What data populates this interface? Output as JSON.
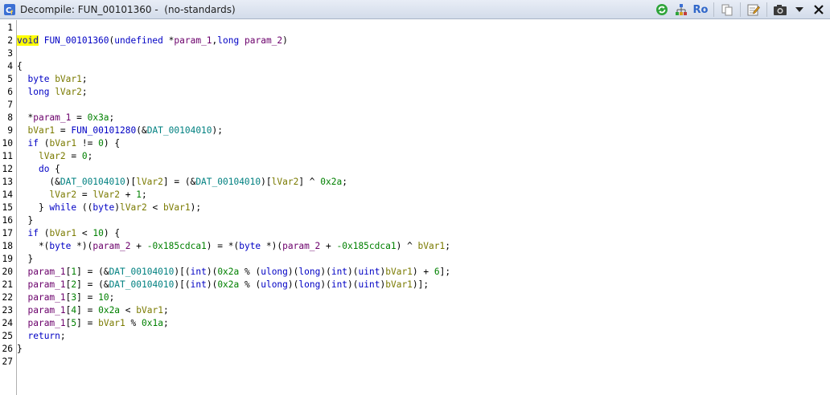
{
  "window": {
    "title": "Decompile: FUN_00101360 -  (no-standards)"
  },
  "toolbar": {
    "ro_label": "Ro",
    "icons": [
      "refresh-icon",
      "graph-icon",
      "read-only-icon",
      "copy-icon",
      "edit-icon",
      "snapshot-icon",
      "menu-dropdown-icon",
      "close-icon"
    ]
  },
  "colors": {
    "keyword": "#0000c4",
    "variable": "#7a7a00",
    "parameter": "#6b006b",
    "constant": "#008000",
    "global": "#008080",
    "highlight": "#ffff00"
  },
  "line_numbers": [
    "1",
    "2",
    "3",
    "4",
    "5",
    "6",
    "7",
    "8",
    "9",
    "10",
    "11",
    "12",
    "13",
    "14",
    "15",
    "16",
    "17",
    "18",
    "19",
    "20",
    "21",
    "22",
    "23",
    "24",
    "25",
    "26",
    "27"
  ],
  "code_lines": [
    [],
    [
      [
        "kw",
        "void"
      ],
      [
        "pl",
        " "
      ],
      [
        "fn",
        "FUN_00101360"
      ],
      [
        "pl",
        "("
      ],
      [
        "ty",
        "undefined"
      ],
      [
        "pl",
        " *"
      ],
      [
        "pm",
        "param_1"
      ],
      [
        "pl",
        ","
      ],
      [
        "ty",
        "long"
      ],
      [
        "pl",
        " "
      ],
      [
        "pm",
        "param_2"
      ],
      [
        "pl",
        ")"
      ]
    ],
    [],
    [
      [
        "pl",
        "{"
      ]
    ],
    [
      [
        "pl",
        "  "
      ],
      [
        "ty",
        "byte"
      ],
      [
        "pl",
        " "
      ],
      [
        "vr",
        "bVar1"
      ],
      [
        "pl",
        ";"
      ]
    ],
    [
      [
        "pl",
        "  "
      ],
      [
        "ty",
        "long"
      ],
      [
        "pl",
        " "
      ],
      [
        "vr",
        "lVar2"
      ],
      [
        "pl",
        ";"
      ]
    ],
    [],
    [
      [
        "pl",
        "  *"
      ],
      [
        "pm",
        "param_1"
      ],
      [
        "pl",
        " = "
      ],
      [
        "nm",
        "0x3a"
      ],
      [
        "pl",
        ";"
      ]
    ],
    [
      [
        "pl",
        "  "
      ],
      [
        "vr",
        "bVar1"
      ],
      [
        "pl",
        " = "
      ],
      [
        "fn",
        "FUN_00101280"
      ],
      [
        "pl",
        "(&"
      ],
      [
        "gv",
        "DAT_00104010"
      ],
      [
        "pl",
        ");"
      ]
    ],
    [
      [
        "pl",
        "  "
      ],
      [
        "kw",
        "if"
      ],
      [
        "pl",
        " ("
      ],
      [
        "vr",
        "bVar1"
      ],
      [
        "pl",
        " != "
      ],
      [
        "nm",
        "0"
      ],
      [
        "pl",
        ") {"
      ]
    ],
    [
      [
        "pl",
        "    "
      ],
      [
        "vr",
        "lVar2"
      ],
      [
        "pl",
        " = "
      ],
      [
        "nm",
        "0"
      ],
      [
        "pl",
        ";"
      ]
    ],
    [
      [
        "pl",
        "    "
      ],
      [
        "kw",
        "do"
      ],
      [
        "pl",
        " {"
      ]
    ],
    [
      [
        "pl",
        "      (&"
      ],
      [
        "gv",
        "DAT_00104010"
      ],
      [
        "pl",
        ")["
      ],
      [
        "vr",
        "lVar2"
      ],
      [
        "pl",
        "] = (&"
      ],
      [
        "gv",
        "DAT_00104010"
      ],
      [
        "pl",
        ")["
      ],
      [
        "vr",
        "lVar2"
      ],
      [
        "pl",
        "] ^ "
      ],
      [
        "nm",
        "0x2a"
      ],
      [
        "pl",
        ";"
      ]
    ],
    [
      [
        "pl",
        "      "
      ],
      [
        "vr",
        "lVar2"
      ],
      [
        "pl",
        " = "
      ],
      [
        "vr",
        "lVar2"
      ],
      [
        "pl",
        " + "
      ],
      [
        "nm",
        "1"
      ],
      [
        "pl",
        ";"
      ]
    ],
    [
      [
        "pl",
        "    } "
      ],
      [
        "kw",
        "while"
      ],
      [
        "pl",
        " (("
      ],
      [
        "ty",
        "byte"
      ],
      [
        "pl",
        ")"
      ],
      [
        "vr",
        "lVar2"
      ],
      [
        "pl",
        " < "
      ],
      [
        "vr",
        "bVar1"
      ],
      [
        "pl",
        ");"
      ]
    ],
    [
      [
        "pl",
        "  }"
      ]
    ],
    [
      [
        "pl",
        "  "
      ],
      [
        "kw",
        "if"
      ],
      [
        "pl",
        " ("
      ],
      [
        "vr",
        "bVar1"
      ],
      [
        "pl",
        " < "
      ],
      [
        "nm",
        "10"
      ],
      [
        "pl",
        ") {"
      ]
    ],
    [
      [
        "pl",
        "    *("
      ],
      [
        "ty",
        "byte"
      ],
      [
        "pl",
        " *)("
      ],
      [
        "pm",
        "param_2"
      ],
      [
        "pl",
        " + "
      ],
      [
        "nm",
        "-0x185cdca1"
      ],
      [
        "pl",
        ") = *("
      ],
      [
        "ty",
        "byte"
      ],
      [
        "pl",
        " *)("
      ],
      [
        "pm",
        "param_2"
      ],
      [
        "pl",
        " + "
      ],
      [
        "nm",
        "-0x185cdca1"
      ],
      [
        "pl",
        ") ^ "
      ],
      [
        "vr",
        "bVar1"
      ],
      [
        "pl",
        ";"
      ]
    ],
    [
      [
        "pl",
        "  }"
      ]
    ],
    [
      [
        "pl",
        "  "
      ],
      [
        "pm",
        "param_1"
      ],
      [
        "pl",
        "["
      ],
      [
        "nm",
        "1"
      ],
      [
        "pl",
        "] = (&"
      ],
      [
        "gv",
        "DAT_00104010"
      ],
      [
        "pl",
        ")[("
      ],
      [
        "ty",
        "int"
      ],
      [
        "pl",
        ")("
      ],
      [
        "nm",
        "0x2a"
      ],
      [
        "pl",
        " % ("
      ],
      [
        "ty",
        "ulong"
      ],
      [
        "pl",
        ")("
      ],
      [
        "ty",
        "long"
      ],
      [
        "pl",
        ")("
      ],
      [
        "ty",
        "int"
      ],
      [
        "pl",
        ")("
      ],
      [
        "ty",
        "uint"
      ],
      [
        "pl",
        ")"
      ],
      [
        "vr",
        "bVar1"
      ],
      [
        "pl",
        ") + "
      ],
      [
        "nm",
        "6"
      ],
      [
        "pl",
        "];"
      ]
    ],
    [
      [
        "pl",
        "  "
      ],
      [
        "pm",
        "param_1"
      ],
      [
        "pl",
        "["
      ],
      [
        "nm",
        "2"
      ],
      [
        "pl",
        "] = (&"
      ],
      [
        "gv",
        "DAT_00104010"
      ],
      [
        "pl",
        ")[("
      ],
      [
        "ty",
        "int"
      ],
      [
        "pl",
        ")("
      ],
      [
        "nm",
        "0x2a"
      ],
      [
        "pl",
        " % ("
      ],
      [
        "ty",
        "ulong"
      ],
      [
        "pl",
        ")("
      ],
      [
        "ty",
        "long"
      ],
      [
        "pl",
        ")("
      ],
      [
        "ty",
        "int"
      ],
      [
        "pl",
        ")("
      ],
      [
        "ty",
        "uint"
      ],
      [
        "pl",
        ")"
      ],
      [
        "vr",
        "bVar1"
      ],
      [
        "pl",
        ")];"
      ]
    ],
    [
      [
        "pl",
        "  "
      ],
      [
        "pm",
        "param_1"
      ],
      [
        "pl",
        "["
      ],
      [
        "nm",
        "3"
      ],
      [
        "pl",
        "] = "
      ],
      [
        "nm",
        "10"
      ],
      [
        "pl",
        ";"
      ]
    ],
    [
      [
        "pl",
        "  "
      ],
      [
        "pm",
        "param_1"
      ],
      [
        "pl",
        "["
      ],
      [
        "nm",
        "4"
      ],
      [
        "pl",
        "] = "
      ],
      [
        "nm",
        "0x2a"
      ],
      [
        "pl",
        " < "
      ],
      [
        "vr",
        "bVar1"
      ],
      [
        "pl",
        ";"
      ]
    ],
    [
      [
        "pl",
        "  "
      ],
      [
        "pm",
        "param_1"
      ],
      [
        "pl",
        "["
      ],
      [
        "nm",
        "5"
      ],
      [
        "pl",
        "] = "
      ],
      [
        "vr",
        "bVar1"
      ],
      [
        "pl",
        " % "
      ],
      [
        "nm",
        "0x1a"
      ],
      [
        "pl",
        ";"
      ]
    ],
    [
      [
        "pl",
        "  "
      ],
      [
        "kw",
        "return"
      ],
      [
        "pl",
        ";"
      ]
    ],
    [
      [
        "pl",
        "}"
      ]
    ],
    []
  ]
}
